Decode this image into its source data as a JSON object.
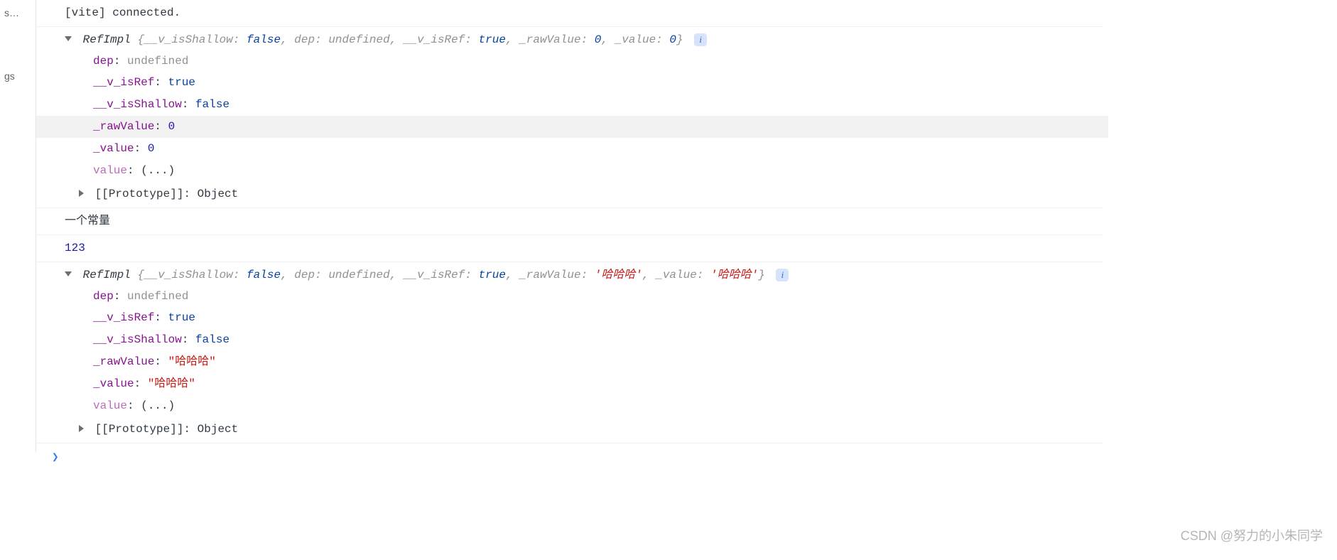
{
  "sidebar": {
    "item1": "s…",
    "item2": "gs"
  },
  "connected": "[vite] connected.",
  "obj1": {
    "class": "RefImpl",
    "preview": {
      "k1": "__v_isShallow",
      "v1": "false",
      "k2": "dep",
      "v2": "undefined",
      "k3": "__v_isRef",
      "v3": "true",
      "k4": "_rawValue",
      "v4": "0",
      "k5": "_value",
      "v5": "0"
    },
    "props": {
      "dep_k": "dep",
      "dep_v": "undefined",
      "isRef_k": "__v_isRef",
      "isRef_v": "true",
      "isShallow_k": "__v_isShallow",
      "isShallow_v": "false",
      "raw_k": "_rawValue",
      "raw_v": "0",
      "val_k": "_value",
      "val_v": "0",
      "value_k": "value",
      "value_v": "(...)",
      "proto_k": "[[Prototype]]",
      "proto_v": "Object"
    }
  },
  "const_label": "一个常量",
  "number_line": "123",
  "obj2": {
    "class": "RefImpl",
    "preview": {
      "k1": "__v_isShallow",
      "v1": "false",
      "k2": "dep",
      "v2": "undefined",
      "k3": "__v_isRef",
      "v3": "true",
      "k4": "_rawValue",
      "v4": "'哈哈哈'",
      "k5": "_value",
      "v5": "'哈哈哈'"
    },
    "props": {
      "dep_k": "dep",
      "dep_v": "undefined",
      "isRef_k": "__v_isRef",
      "isRef_v": "true",
      "isShallow_k": "__v_isShallow",
      "isShallow_v": "false",
      "raw_k": "_rawValue",
      "raw_v": "\"哈哈哈\"",
      "val_k": "_value",
      "val_v": "\"哈哈哈\"",
      "value_k": "value",
      "value_v": "(...)",
      "proto_k": "[[Prototype]]",
      "proto_v": "Object"
    }
  },
  "info": "i",
  "watermark": "CSDN @努力的小朱同学"
}
